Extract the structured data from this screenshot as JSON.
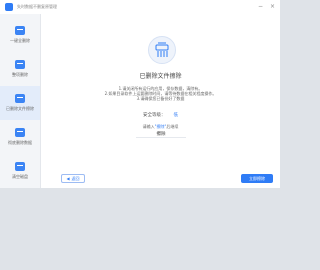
{
  "window": {
    "title": "失时数据不删复原管理",
    "controls": {
      "minimize": "−",
      "close": "×"
    }
  },
  "sidebar": {
    "items": [
      {
        "label": "一键全删除",
        "icon": "eraser-icon"
      },
      {
        "label": "整项删除",
        "icon": "folder-delete-icon"
      },
      {
        "label": "已删除文件擦除",
        "icon": "file-shred-icon",
        "active": true
      },
      {
        "label": "彻底删除数据",
        "icon": "trash-icon"
      },
      {
        "label": "清空磁盘",
        "icon": "disk-icon"
      }
    ]
  },
  "main": {
    "title": "已删除文件擦除",
    "notes": [
      "1.请关闭所有运行的应用，保存数据，清除有。",
      "2.如果目录软件上运要删除时间，请等待数据在相关程度操作。",
      "3.请确保您已备份好了数据"
    ],
    "security_label": "安全等级：",
    "security_level": "低",
    "confirm_prefix": "请输入",
    "confirm_keyword": "\"擦除\"",
    "confirm_suffix": "后继续",
    "confirm_value": "擦除",
    "back_label": "返回",
    "start_label": "立即擦除"
  },
  "colors": {
    "accent": "#2f7cf6",
    "sidebar_bg": "#f3f5f8",
    "active_bg": "#e3ecfa"
  }
}
